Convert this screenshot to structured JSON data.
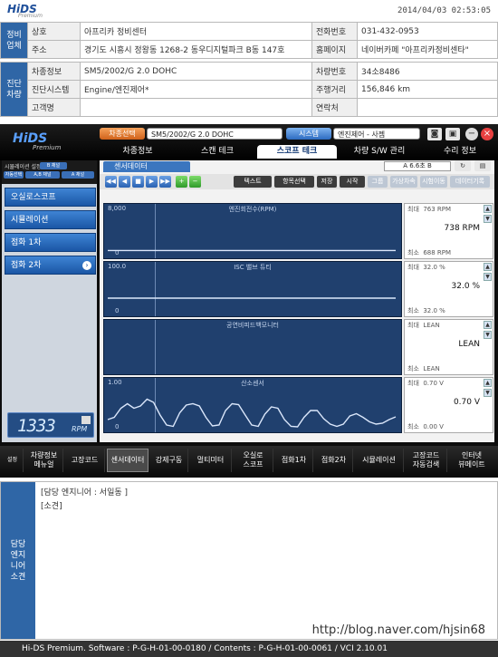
{
  "report": {
    "logo": "HiDS",
    "logo_sub": "Premium",
    "datetime": "2014/04/03 02:53:05",
    "shop": {
      "section": "정비\n업체",
      "name_label": "상호",
      "name": "아프리카 정비센터",
      "phone_label": "전화번호",
      "phone": "031-432-0953",
      "address_label": "주소",
      "address": "경기도 시흥시 정왕동 1268-2 동우디지털파크 B동 147호",
      "homepage_label": "홈페이지",
      "homepage": "네이버카페 \"아프리카정비센타\""
    },
    "vehicle": {
      "section": "진단\n차량",
      "info_label": "차종정보",
      "info": "SM5/2002/G 2.0 DOHC",
      "plate_label": "차량번호",
      "plate": "34소8486",
      "system_label": "진단시스템",
      "system": "Engine/엔진제어*",
      "mileage_label": "주행거리",
      "mileage": "156,846 km",
      "customer_label": "고객명",
      "customer": "",
      "contact_label": "연락처",
      "contact": ""
    }
  },
  "app": {
    "logo": "HiDS",
    "logo_sub": "Premium",
    "model_button": "차종선택",
    "model_value": "SM5/2002/G 2.0 DOHC",
    "system_button": "시스템",
    "system_value": "엔진제어 - 사젬",
    "tabs": [
      "차종정보",
      "스캔 테크",
      "스코프 테크",
      "차량 S/W 관리",
      "수리 정보"
    ],
    "active_tab": 2,
    "mini_title": "시뮬레이션 설정",
    "mini_chips": [
      "B 채널",
      "자동선택",
      "A,B 채널",
      "A 채널"
    ],
    "left_menu": [
      "오실로스코프",
      "시뮬레이션",
      "점화 1차",
      "점화 2차"
    ],
    "rpm_value": "1333",
    "rpm_unit": "RPM",
    "sensor_tab": "센서데이터",
    "zoom_label": "A   6.6초   B",
    "toolbar_buttons": [
      "텍스트",
      "항목선택",
      "저장",
      "시작",
      "그룹",
      "가상차속",
      "시험이동",
      "데이터기록"
    ],
    "bottom_toolbar": [
      "설정",
      "차량정보\n메뉴얼",
      "고장코드",
      "센서데이터",
      "강제구동",
      "멀티미터",
      "오실로\n스코프",
      "점화1차",
      "점화2차",
      "시뮬레이션",
      "고장코드\n자동검색",
      "인터넷\n뷰메이트"
    ]
  },
  "chart_data": [
    {
      "type": "line",
      "title": "엔진회전수(RPM)",
      "ylim": [
        0,
        8000
      ],
      "y_tick_labels": [
        "8,000",
        "0"
      ],
      "max_label": "최대",
      "max": "763 RPM",
      "current": "738 RPM",
      "min_label": "최소",
      "min": "688 RPM",
      "series": [
        {
          "values": [
            738,
            738,
            738,
            738,
            738,
            738,
            738,
            738,
            738,
            738,
            738,
            738,
            738,
            738,
            738,
            738
          ]
        }
      ]
    },
    {
      "type": "line",
      "title": "ISC 밸브 듀티",
      "ylim": [
        0,
        100
      ],
      "y_tick_labels": [
        "100.0",
        "0"
      ],
      "max_label": "최대",
      "max": "32.0 %",
      "current": "32.0 %",
      "min_label": "최소",
      "min": "32.0 %",
      "series": [
        {
          "values": [
            32,
            32,
            32,
            32,
            32,
            32,
            32,
            32,
            32,
            32,
            32,
            32,
            32,
            32,
            32,
            32
          ]
        }
      ]
    },
    {
      "type": "line",
      "title": "공연비피드백모니터",
      "ylim": [
        0,
        1
      ],
      "y_tick_labels": [
        "",
        ""
      ],
      "max_label": "최대",
      "max": "LEAN",
      "current": "LEAN",
      "min_label": "최소",
      "min": "LEAN",
      "series": [
        {
          "values": []
        }
      ]
    },
    {
      "type": "line",
      "title": "산소센서",
      "ylim": [
        0,
        1
      ],
      "y_tick_labels": [
        "1.00",
        "0"
      ],
      "max_label": "최대",
      "max": "0.70 V",
      "current": "0.70 V",
      "min_label": "최소",
      "min": "0.00 V",
      "series": [
        {
          "values": [
            0.2,
            0.25,
            0.45,
            0.55,
            0.45,
            0.5,
            0.65,
            0.58,
            0.3,
            0.08,
            0.05,
            0.35,
            0.52,
            0.55,
            0.5,
            0.25,
            0.06,
            0.08,
            0.4,
            0.55,
            0.53,
            0.3,
            0.08,
            0.05,
            0.32,
            0.48,
            0.45,
            0.2,
            0.05,
            0.04,
            0.25,
            0.4,
            0.4,
            0.22,
            0.1,
            0.05,
            0.1,
            0.28,
            0.33,
            0.25,
            0.15,
            0.1,
            0.12,
            0.2,
            0.26
          ]
        }
      ]
    }
  ],
  "memo": {
    "section": "담당\n엔지\n니어\n소견",
    "line1": "[담당 엔지니어 : 서일동 ]",
    "line2": "[소견]"
  },
  "watermark_url": "http://blog.naver.com/hjsin68",
  "footer": "Hi-DS Premium.   Software : P-G-H-01-00-0180  /   Contents : P-G-H-01-00-0061  /   VCI 2.10.01"
}
